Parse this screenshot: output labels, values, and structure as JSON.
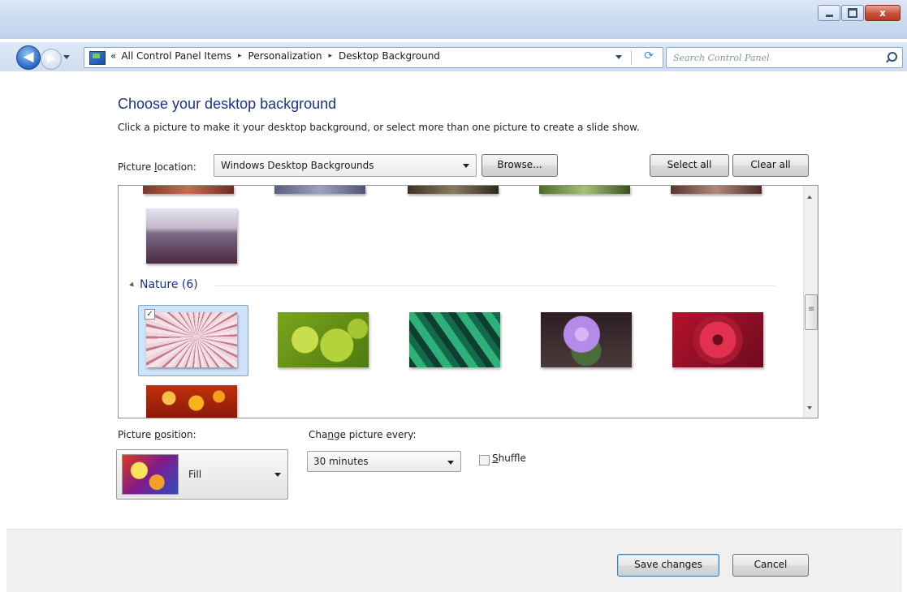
{
  "window": {
    "close_glyph": "x"
  },
  "nav": {
    "breadcrumb_lead": "«",
    "breadcrumbs": [
      "All Control Panel Items",
      "Personalization",
      "Desktop Background"
    ],
    "separator": "▸",
    "search_placeholder": "Search Control Panel"
  },
  "page": {
    "title": "Choose your desktop background",
    "instructions": "Click a picture to make it your desktop background, or select more than one picture to create a slide show."
  },
  "location": {
    "label": "Picture location:",
    "value": "Windows Desktop Backgrounds",
    "browse_label": "Browse...",
    "select_all_label": "Select all",
    "clear_all_label": "Clear all"
  },
  "gallery": {
    "group_label": "Nature (6)",
    "colors": {
      "lavender": [
        "#7c6a8a",
        "#4b2a3f"
      ],
      "fiber": [
        "#e3b7c6",
        "#8e4f62"
      ],
      "green_orbs": [
        "#c9de4c",
        "#4f7a10"
      ],
      "green_leaves": [
        "#2fb07a",
        "#0c3f30"
      ],
      "purple_thistle": [
        "#b58ae8",
        "#2c1d22"
      ],
      "red_dahlia": [
        "#e2314e",
        "#6c0c1f"
      ],
      "orange_bokeh": [
        "#f7b21f",
        "#8a1a08"
      ]
    }
  },
  "position": {
    "label": "Picture position:",
    "value": "Fill"
  },
  "interval": {
    "label": "Change picture every:",
    "value": "30 minutes",
    "shuffle_label": "Shuffle",
    "shuffle_checked": false
  },
  "footer": {
    "save_label": "Save changes",
    "cancel_label": "Cancel"
  }
}
